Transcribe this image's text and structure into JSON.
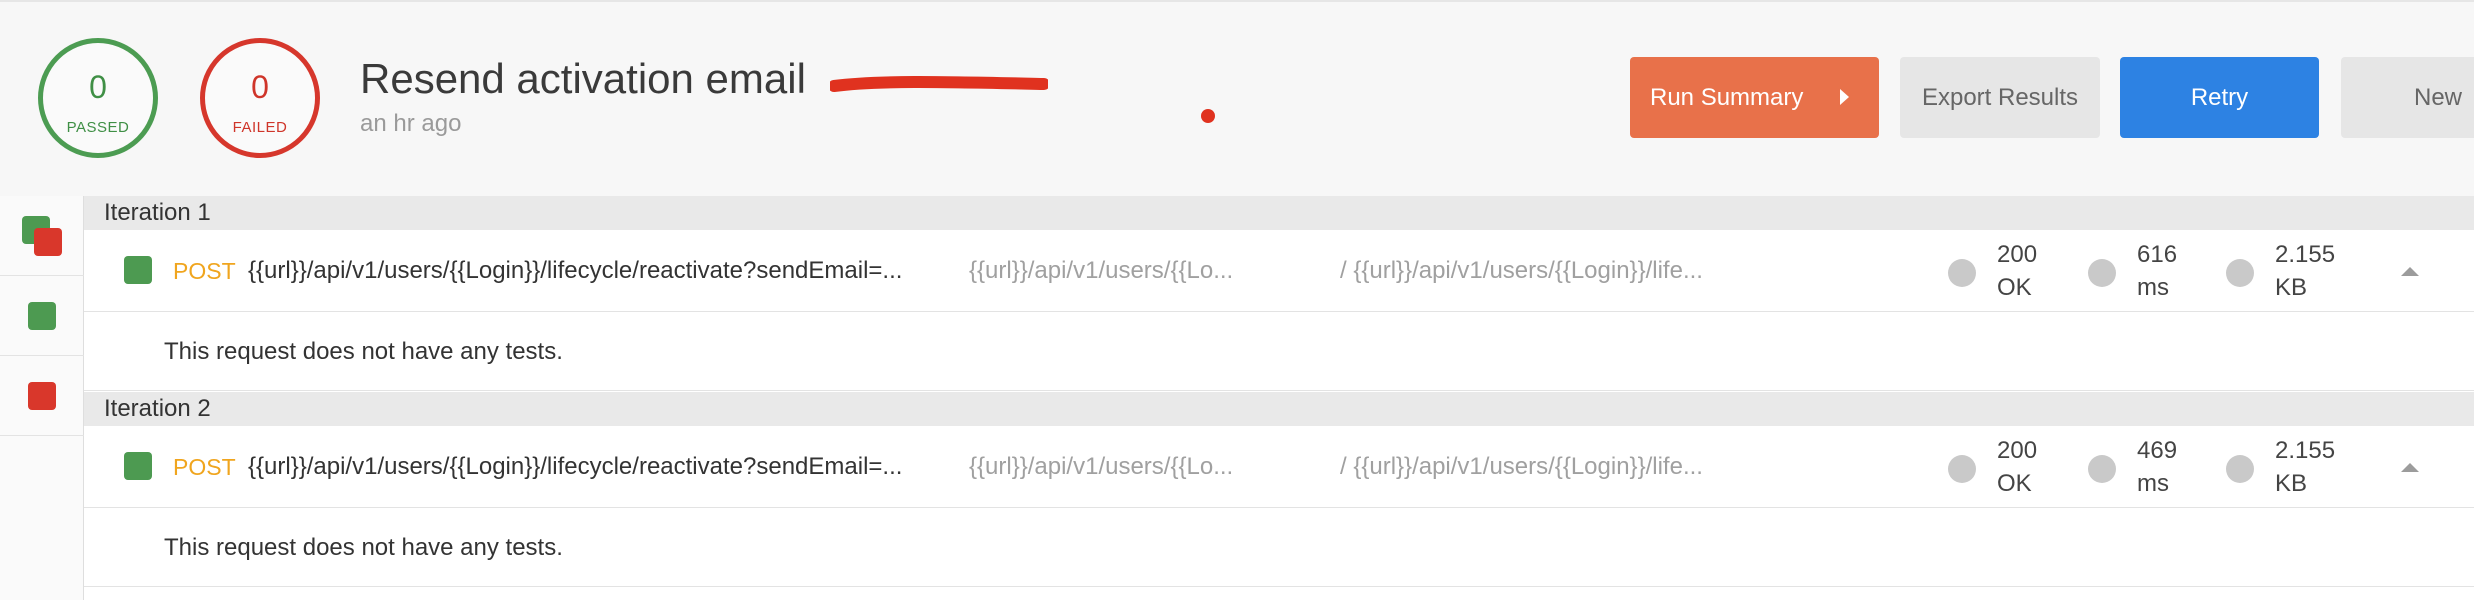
{
  "summary": {
    "passed": {
      "count": "0",
      "label": "PASSED"
    },
    "failed": {
      "count": "0",
      "label": "FAILED"
    }
  },
  "header": {
    "title": "Resend activation email",
    "time_ago": "an hr ago"
  },
  "actions": {
    "run_summary": "Run Summary",
    "export_results": "Export Results",
    "retry": "Retry",
    "new": "New"
  },
  "colors": {
    "passed": "#4c9c52",
    "failed": "#d6372c",
    "run_summary_bg": "#e8714a",
    "retry_bg": "#2d82e3",
    "method": "#f0a51e"
  },
  "iterations": [
    {
      "label": "Iteration 1",
      "request": {
        "method": "POST",
        "url": "{{url}}/api/v1/users/{{Login}}/lifecycle/reactivate?sendEmail=...",
        "name": "{{url}}/api/v1/users/{{Lo...",
        "path": "/ {{url}}/api/v1/users/{{Login}}/life...",
        "status": {
          "code": "200",
          "text": "OK"
        },
        "time": {
          "value": "616",
          "unit": "ms"
        },
        "size": {
          "value": "2.155",
          "unit": "KB"
        },
        "tests_message": "This request does not have any tests."
      }
    },
    {
      "label": "Iteration 2",
      "request": {
        "method": "POST",
        "url": "{{url}}/api/v1/users/{{Login}}/lifecycle/reactivate?sendEmail=...",
        "name": "{{url}}/api/v1/users/{{Lo...",
        "path": "/ {{url}}/api/v1/users/{{Login}}/life...",
        "status": {
          "code": "200",
          "text": "OK"
        },
        "time": {
          "value": "469",
          "unit": "ms"
        },
        "size": {
          "value": "2.155",
          "unit": "KB"
        },
        "tests_message": "This request does not have any tests."
      }
    }
  ]
}
